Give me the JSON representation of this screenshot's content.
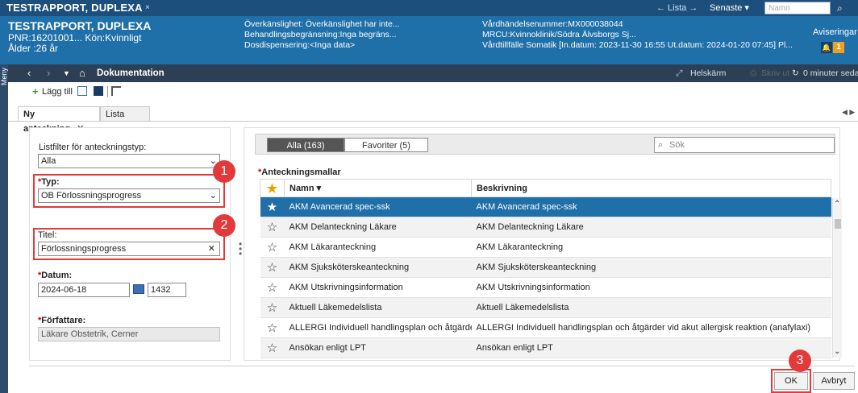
{
  "app": {
    "tab_title": "TESTRAPPORT, DUPLEXA",
    "tab_close": "×",
    "nav_list": "← Lista →",
    "nav_recent": "Senaste ▾",
    "search_placeholder": "Namn",
    "search_icon": "magnifier-icon"
  },
  "patient": {
    "name": "TESTRAPPORT, DUPLEXA",
    "pnr_line": "PNR:16201001... Kön:Kvinnligt",
    "age": "Ålder :26 år",
    "info_col1": [
      "Överkänslighet: Överkänslighet har inte...",
      "Behandlingsbegränsning:Inga begräns...",
      "Dosdispensering:<Inga data>"
    ],
    "info_col2": [
      "Vårdhändelsenummer:MX000038044",
      "MRCU:Kvinnoklinik/Södra Älvsborgs Sj...",
      "Vårdtillfälle Somatik [In.datum: 2023-11-30 16:55 Ut.datum: 2024-01-20 07:45] Pl..."
    ],
    "notifications_label": "Aviseringar",
    "notifications_count": "1"
  },
  "sidebar": {
    "label": "Meny"
  },
  "navbar": {
    "title": "Dokumentation",
    "fullscreen": "Helskärm",
    "print": "Skriv ut",
    "refresh": "0 minuter sedan"
  },
  "toolbar": {
    "add_label": "Lägg till"
  },
  "tabs": {
    "active": "Ny anteckning",
    "close": "✕",
    "list": "Lista"
  },
  "form": {
    "list_filter_label": "Listfilter för anteckningstyp:",
    "list_filter_value": "Alla",
    "type_label": "Typ:",
    "type_value": "OB Förlossningsprogress",
    "title_label": "Titel:",
    "title_value": "Förlossningsprogress",
    "date_label": "Datum:",
    "date_value": "2024-06-18",
    "time_value": "1432",
    "author_label": "Författare:",
    "author_value": "Läkare Obstetrik, Cerner"
  },
  "callouts": [
    "1",
    "2",
    "3"
  ],
  "templates": {
    "tab_all": "Alla (163)",
    "tab_fav": "Favoriter (5)",
    "search_placeholder": "Sök",
    "section_title": "Anteckningsmallar",
    "columns": [
      "Namn ▾",
      "Beskrivning"
    ],
    "rows": [
      {
        "name": "AKM Avancerad spec-ssk",
        "desc": "AKM Avancerad spec-ssk",
        "fav": true
      },
      {
        "name": "AKM Delanteckning Läkare",
        "desc": "AKM Delanteckning Läkare",
        "fav": false
      },
      {
        "name": "AKM Läkaranteckning",
        "desc": "AKM Läkaranteckning",
        "fav": false
      },
      {
        "name": "AKM Sjuksköterskeanteckning",
        "desc": "AKM Sjuksköterskeanteckning",
        "fav": false
      },
      {
        "name": "AKM Utskrivningsinformation",
        "desc": "AKM Utskrivningsinformation",
        "fav": false
      },
      {
        "name": "Aktuell Läkemedelslista",
        "desc": "Aktuell Läkemedelslista",
        "fav": false
      },
      {
        "name": "ALLERGI Individuell handlingsplan och åtgärder vid",
        "desc": "ALLERGI Individuell handlingsplan och åtgärder vid akut allergisk reaktion (anafylaxi)",
        "fav": false
      },
      {
        "name": "Ansökan enligt LPT",
        "desc": "Ansökan enligt LPT",
        "fav": false
      }
    ]
  },
  "footer": {
    "ok": "OK",
    "cancel": "Avbryt"
  },
  "colors": {
    "accent": "#1f6fa8",
    "callout": "#e23a3a",
    "header": "#1d4f7c"
  }
}
